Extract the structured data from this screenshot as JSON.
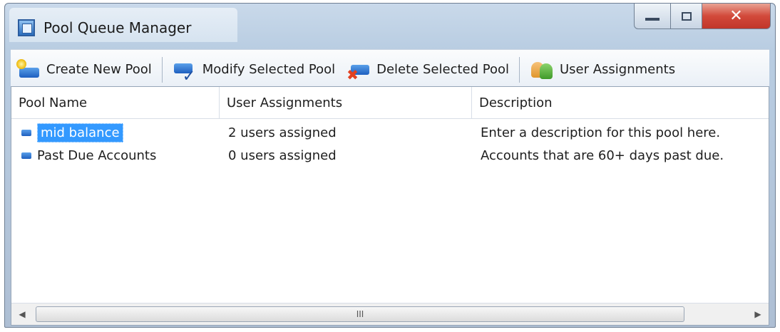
{
  "window": {
    "title": "Pool Queue Manager"
  },
  "toolbar": {
    "create_label": "Create New Pool",
    "modify_label": "Modify Selected Pool",
    "delete_label": "Delete Selected Pool",
    "users_label": "User Assignments"
  },
  "list": {
    "columns": [
      "Pool Name",
      "User Assignments",
      "Description"
    ],
    "rows": [
      {
        "name": "mid balance",
        "assignments": "2 users assigned",
        "description": "Enter a description for this pool here.",
        "selected": true
      },
      {
        "name": "Past Due Accounts",
        "assignments": "0 users assigned",
        "description": "Accounts that are 60+ days past due.",
        "selected": false
      }
    ]
  },
  "scrollbar": {
    "grip": "III"
  },
  "colors": {
    "selection": "#3399ff",
    "close_button": "#d2493a"
  }
}
